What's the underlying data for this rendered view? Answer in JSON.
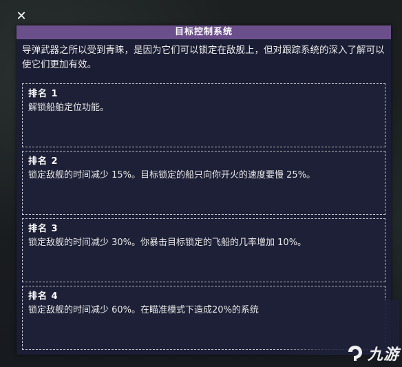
{
  "close_icon": "close-icon",
  "panel": {
    "title": "目标控制系统",
    "description": "导弹武器之所以受到青睐，是因为它们可以锁定在敌舰上，但对跟踪系统的深入了解可以使它们更加有效。"
  },
  "ranks": [
    {
      "title": "排名 1",
      "text": "解锁船舶定位功能。"
    },
    {
      "title": "排名 2",
      "text": "锁定敌舰的时间减少 15%。目标锁定的船只向你开火的速度要慢 25%。"
    },
    {
      "title": "排名 3",
      "text": "锁定敌舰的时间减少 30%。你暴击目标锁定的飞船的几率增加 10%。"
    },
    {
      "title": "排名 4",
      "text": "锁定敌舰的时间减少 60%。在瞄准模式下造成20%的系统"
    }
  ],
  "watermark": {
    "brand": "九游",
    "icon": "jiuyou-logo-icon"
  },
  "colors": {
    "header": "#6b4f8a",
    "panel_bg": "#1a1d33",
    "card_border": "#c7c7d0"
  }
}
